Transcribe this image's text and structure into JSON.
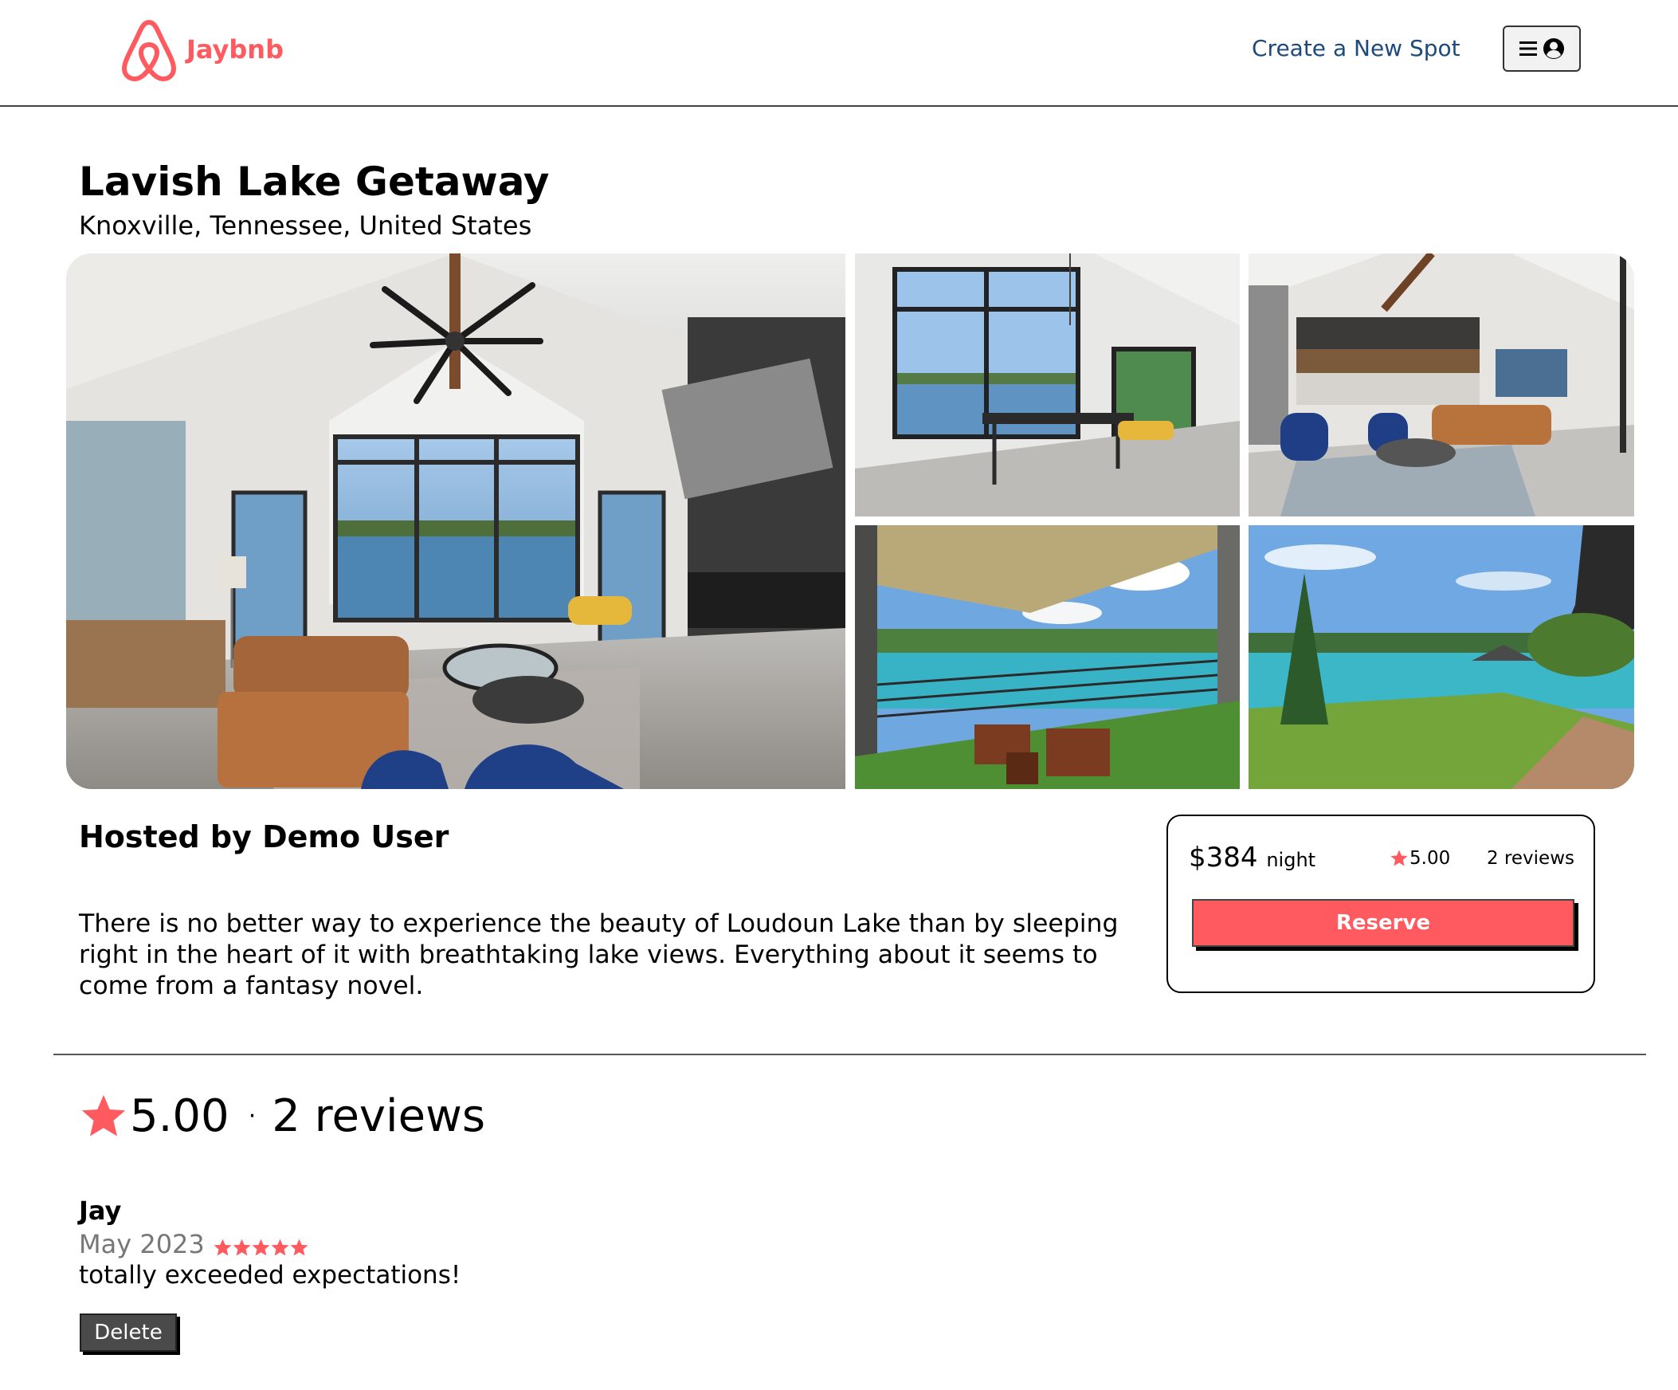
{
  "header": {
    "logo_text": "Jaybnb",
    "create_spot_label": "Create a New Spot",
    "menu_icons": [
      "hamburger-icon",
      "user-circle-icon"
    ]
  },
  "spot": {
    "title": "Lavish Lake Getaway",
    "location": "Knoxville, Tennessee, United States",
    "host_line": "Hosted by Demo User",
    "description": "There is no better way to experience the beauty of Loudoun Lake than by sleeping right in the heart of it with breathtaking lake views. Everything about it seems to come from a fantasy novel."
  },
  "photos": [
    {
      "name": "main-living-room-photo"
    },
    {
      "name": "dining-room-photo"
    },
    {
      "name": "loft-living-area-photo"
    },
    {
      "name": "covered-porch-lake-view-photo"
    },
    {
      "name": "lakeside-lawn-photo"
    }
  ],
  "booking": {
    "price": "$384",
    "price_unit": "night",
    "rating": "5.00",
    "reviews_count": "2 reviews",
    "reserve_label": "Reserve"
  },
  "reviews_summary": {
    "rating": "5.00",
    "separator": "·",
    "count": "2 reviews"
  },
  "reviews": [
    {
      "author": "Jay",
      "date": "May 2023",
      "stars": 5,
      "text": "totally exceeded expectations!",
      "delete_label": "Delete"
    }
  ],
  "colors": {
    "brand": "#ff5a5f",
    "link": "#1c4a7e",
    "delete_button": "#4a4a4a"
  }
}
